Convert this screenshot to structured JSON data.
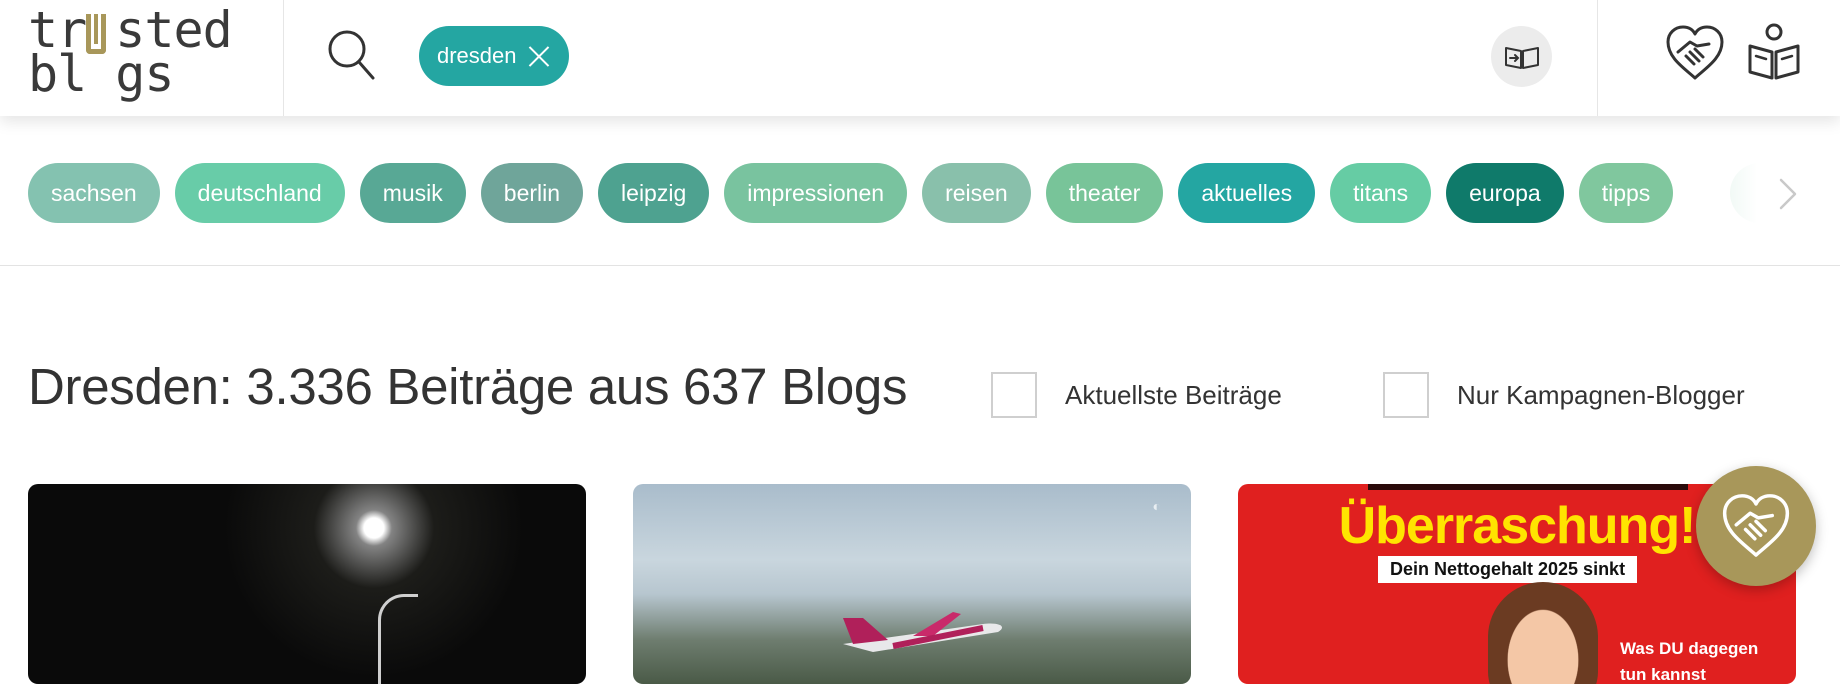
{
  "header": {
    "logo_line1": "tr sted",
    "logo_line2": "bl gs",
    "active_tag": "dresden"
  },
  "tags": [
    {
      "label": "sachsen",
      "color": "#84c2b0"
    },
    {
      "label": "deutschland",
      "color": "#68cca8"
    },
    {
      "label": "musik",
      "color": "#58a895"
    },
    {
      "label": "berlin",
      "color": "#6fa59a"
    },
    {
      "label": "leipzig",
      "color": "#4ea290"
    },
    {
      "label": "impressionen",
      "color": "#79c39f"
    },
    {
      "label": "reisen",
      "color": "#89c0ab"
    },
    {
      "label": "theater",
      "color": "#78c499"
    },
    {
      "label": "aktuelles",
      "color": "#24a6a2"
    },
    {
      "label": "titans",
      "color": "#66cca4"
    },
    {
      "label": "europa",
      "color": "#0f7a6a"
    },
    {
      "label": "tipps",
      "color": "#80c79e"
    }
  ],
  "results": {
    "title": "Dresden: 3.336 Beiträge aus 637 Blogs",
    "filter_latest": "Aktuellste Beiträge",
    "filter_campaign": "Nur Kampagnen-Blogger"
  },
  "cards": {
    "card3_headline": "Überraschung!",
    "card3_sub": "Dein Nettogehalt 2025 sinkt",
    "card3_side_1": "Was DU dagegen",
    "card3_side_2": "tun kannst"
  },
  "colors": {
    "accent_teal": "#24a6a2",
    "brand_gold": "#a8975a"
  }
}
